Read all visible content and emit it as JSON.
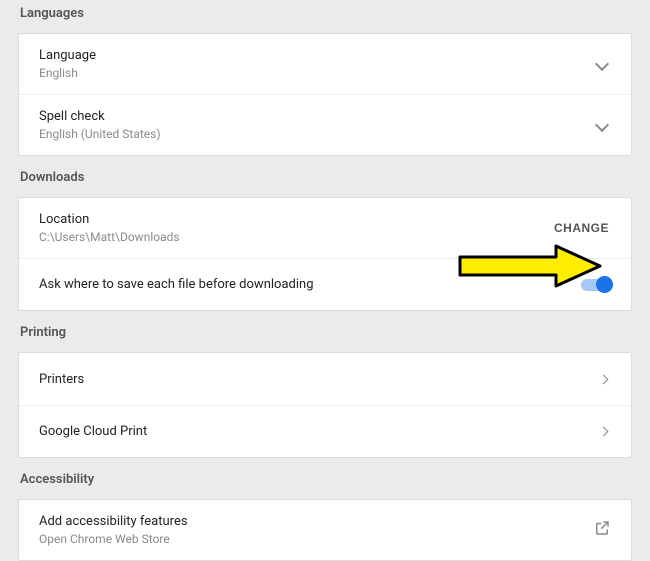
{
  "sections": {
    "languages": {
      "title": "Languages",
      "language": {
        "title": "Language",
        "value": "English"
      },
      "spellcheck": {
        "title": "Spell check",
        "value": "English (United States)"
      }
    },
    "downloads": {
      "title": "Downloads",
      "location": {
        "title": "Location",
        "path": "C:\\Users\\Matt\\Downloads",
        "change": "CHANGE"
      },
      "askWhere": {
        "title": "Ask where to save each file before downloading"
      }
    },
    "printing": {
      "title": "Printing",
      "printers": "Printers",
      "cloudPrint": "Google Cloud Print"
    },
    "accessibility": {
      "title": "Accessibility",
      "add": {
        "title": "Add accessibility features",
        "sub": "Open Chrome Web Store"
      }
    }
  }
}
